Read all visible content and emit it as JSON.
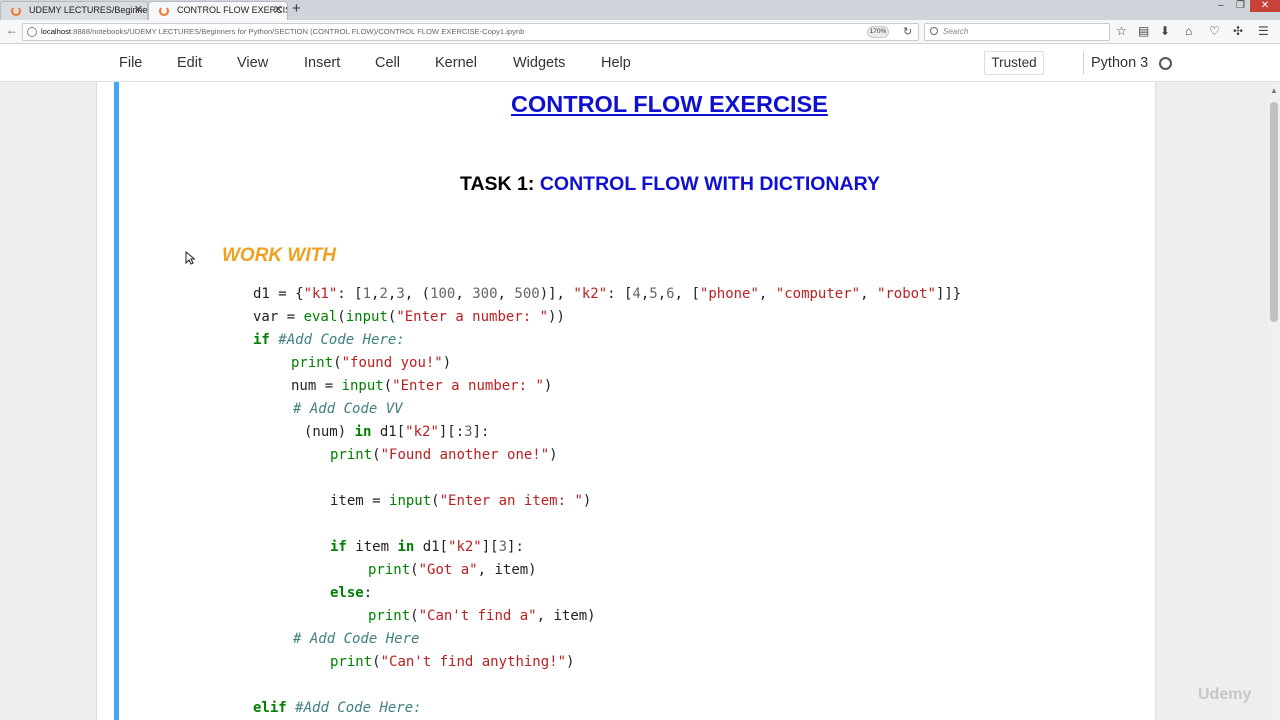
{
  "browser": {
    "tabs": [
      {
        "label": "UDEMY LECTURES/Beginners",
        "active": false
      },
      {
        "label": "CONTROL FLOW EXERCISE",
        "active": true
      }
    ],
    "address_host": "localhost",
    "address_path": ":8888/notebooks/UDEMY LECTURES/Beginners for Python/SECTION (CONTROL FLOW)/CONTROL FLOW EXERCISE-Copy1.ipynb",
    "zoom": "170%",
    "search_placeholder": "Search"
  },
  "jupyter": {
    "menu": [
      "File",
      "Edit",
      "View",
      "Insert",
      "Cell",
      "Kernel",
      "Widgets",
      "Help"
    ],
    "trusted_label": "Trusted",
    "kernel_name": "Python 3"
  },
  "notebook": {
    "title": "CONTROL FLOW EXERCISE",
    "task_label": "TASK 1:",
    "task_title": "CONTROL FLOW WITH DICTIONARY",
    "work_with": "WORK WITH"
  },
  "watermark": "Udemy",
  "colors": {
    "title_blue": "#1010d0",
    "work_with_orange": "#f0a020",
    "selected_cell_bar": "#42a5f5",
    "keyword_green": "#008000",
    "string_red": "#ba2121",
    "comment_teal": "#408080"
  }
}
